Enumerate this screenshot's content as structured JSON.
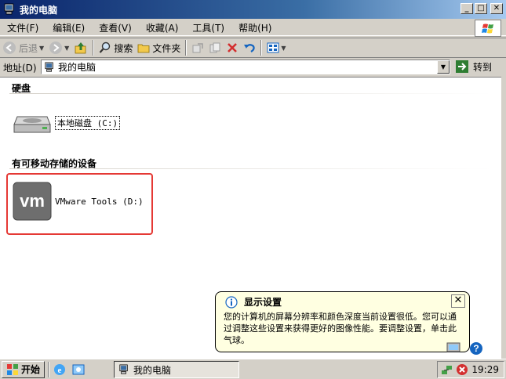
{
  "window": {
    "title": "我的电脑",
    "minimize_label": "_",
    "restore_label": "□",
    "close_label": "✕"
  },
  "menu": {
    "items": [
      "文件(F)",
      "编辑(E)",
      "查看(V)",
      "收藏(A)",
      "工具(T)",
      "帮助(H)"
    ]
  },
  "toolbar": {
    "back_label": "后退",
    "search_label": "搜索",
    "folders_label": "文件夹"
  },
  "address": {
    "label": "地址(D)",
    "value": "我的电脑",
    "go_label": "转到"
  },
  "content": {
    "group_hdd": "硬盘",
    "drive_c": "本地磁盘 (C:)",
    "group_removable": "有可移动存储的设备",
    "drive_d": "VMware Tools (D:)"
  },
  "balloon": {
    "title": "显示设置",
    "body": "您的计算机的屏幕分辨率和颜色深度当前设置很低。您可以通过调整这些设置来获得更好的图像性能。要调整设置，单击此气球。"
  },
  "taskbar": {
    "start_label": "开始",
    "task_label": "我的电脑",
    "clock": "19:29"
  },
  "colors": {
    "title_gradient_start": "#0a246a",
    "balloon_bg": "#ffffe1",
    "highlight": "#e53935"
  }
}
